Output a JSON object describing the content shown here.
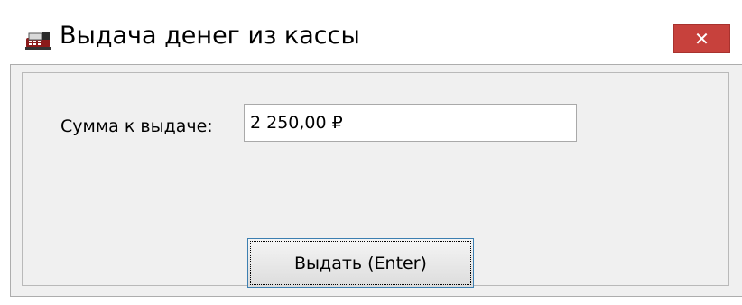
{
  "window": {
    "title": "Выдача денег из кассы",
    "icon": "cash-register-icon",
    "close_glyph": "✕",
    "close_color": "#c7413c"
  },
  "form": {
    "amount_label": "Сумма к выдаче:",
    "amount_value": "2 250,00 ₽"
  },
  "actions": {
    "issue_label": "Выдать (Enter)"
  }
}
